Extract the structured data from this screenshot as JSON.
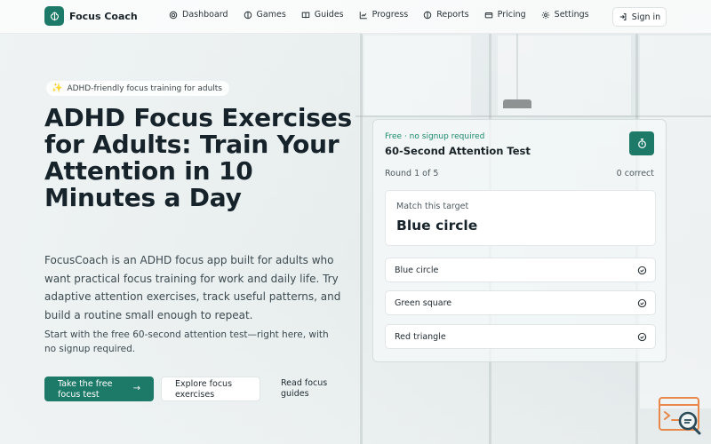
{
  "brand": {
    "name": "Focus Coach",
    "color": "#1e7a68"
  },
  "nav": {
    "items": [
      {
        "label": "Dashboard",
        "icon": "gauge-icon"
      },
      {
        "label": "Games",
        "icon": "brain-icon"
      },
      {
        "label": "Guides",
        "icon": "book-icon"
      },
      {
        "label": "Progress",
        "icon": "chart-line-icon"
      },
      {
        "label": "Reports",
        "icon": "brain-icon"
      },
      {
        "label": "Pricing",
        "icon": "credit-card-icon"
      },
      {
        "label": "Settings",
        "icon": "gear-icon"
      }
    ],
    "signin_label": "Sign in"
  },
  "hero": {
    "pill": "ADHD-friendly focus training for adults",
    "title": "ADHD Focus Exercises for Adults: Train Your Attention in 10 Minutes a Day",
    "body": "FocusCoach is an ADHD focus app built for adults who want practical focus training for work and daily life. Try adaptive attention exercises, track useful patterns, and build a routine small enough to repeat.",
    "note": "Start with the free 60-second attention test—right here, with no signup required.",
    "cta_primary": "Take the free focus test",
    "cta_secondary": "Explore focus exercises",
    "cta_link": "Read focus guides"
  },
  "test_card": {
    "badge": "Free · no signup required",
    "title": "60-Second Attention Test",
    "round": "Round 1 of 5",
    "correct": "0 correct",
    "target_label": "Match this target",
    "target_value": "Blue circle",
    "options": [
      "Blue circle",
      "Green square",
      "Red triangle"
    ]
  },
  "colors": {
    "accent": "#1e7a68",
    "accent_text": "#1e8a6e",
    "logo_orange": "#e8884a"
  }
}
